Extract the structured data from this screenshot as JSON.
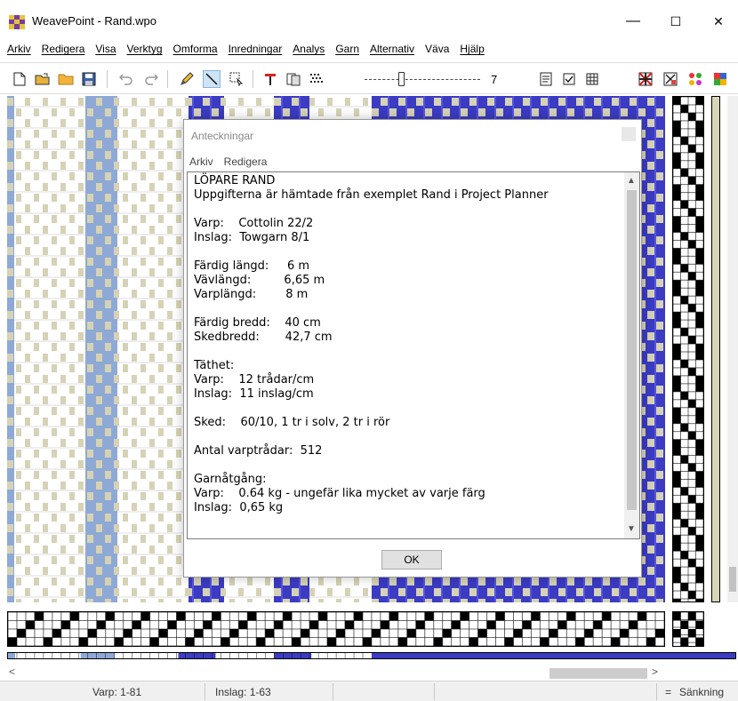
{
  "window": {
    "title": "WeavePoint - Rand.wpo",
    "minimize": "—",
    "maximize": "☐",
    "close": "✕"
  },
  "menu": {
    "items": [
      "Arkiv",
      "Redigera",
      "Visa",
      "Verktyg",
      "Omforma",
      "Inredningar",
      "Analys",
      "Garn",
      "Alternativ",
      "Väva",
      "Hjälp"
    ]
  },
  "toolbar": {
    "zoom_value": "7",
    "icons": [
      "new-file-icon",
      "open-icon",
      "open-folder-icon",
      "save-icon",
      "undo-icon",
      "redo-icon",
      "pencil-icon",
      "line-icon",
      "select-icon",
      "color-icon",
      "copy-icon",
      "pattern-icon",
      "notes-icon",
      "check-icon",
      "grid-icon",
      "flag-icon",
      "checkbox-icon",
      "palette-icon",
      "colors-grid-icon"
    ]
  },
  "colors": {
    "warp_light_blue": "#8ea9d6",
    "warp_blue": "#3b3bc4",
    "weft_beige": "#d6d2b6",
    "weave_white": "#ffffff"
  },
  "dialog": {
    "title": "Anteckningar",
    "menu": [
      "Arkiv",
      "Redigera"
    ],
    "ok_label": "OK",
    "notes": [
      "LÖPARE RAND",
      "Uppgifterna är hämtade från exemplet Rand i Project Planner",
      "",
      "Varp:    Cottolin 22/2",
      "Inslag:  Towgarn 8/1",
      "",
      "Färdig längd:     6 m",
      "Vävlängd:         6,65 m",
      "Varplängd:        8 m",
      "",
      "Färdig bredd:    40 cm",
      "Skedbredd:       42,7 cm",
      "",
      "Täthet:",
      "Varp:    12 trådar/cm",
      "Inslag:  11 inslag/cm",
      "",
      "Sked:    60/10, 1 tr i solv, 2 tr i rör",
      "",
      "Antal varptrådar:  512",
      "",
      "Garnåtgång:",
      "Varp:    0.64 kg - ungefär lika mycket av varje färg",
      "Inslag:  0,65 kg"
    ]
  },
  "status": {
    "varp": "Varp: 1-81",
    "inslag": "Inslag: 1-63",
    "eq": "=",
    "mode": "Sänkning"
  }
}
